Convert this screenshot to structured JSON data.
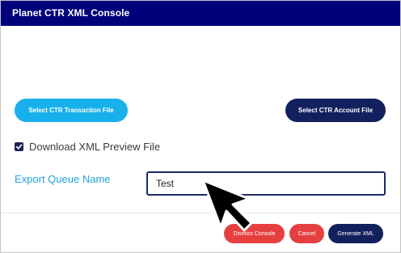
{
  "window": {
    "title": "Planet CTR XML Console",
    "colors": {
      "title_bar": "#00007a",
      "cyan_button": "#18b0ea",
      "navy_button": "#13205e",
      "red_button": "#e5403f",
      "label_accent": "#1ea3de"
    }
  },
  "file_buttons": {
    "transaction_label": "Select CTR Transaction File",
    "account_label": "Select CTR Account File"
  },
  "preview_option": {
    "checked": true,
    "label": "Download XML Preview File"
  },
  "export_queue": {
    "label": "Export Queue Name",
    "value": "Test"
  },
  "footer": {
    "dismiss_label": "Dismiss Console",
    "cancel_label": "Cancel",
    "generate_label": "Generate XML"
  },
  "pointer": {
    "icon": "mouse-pointer-arrow-icon"
  }
}
